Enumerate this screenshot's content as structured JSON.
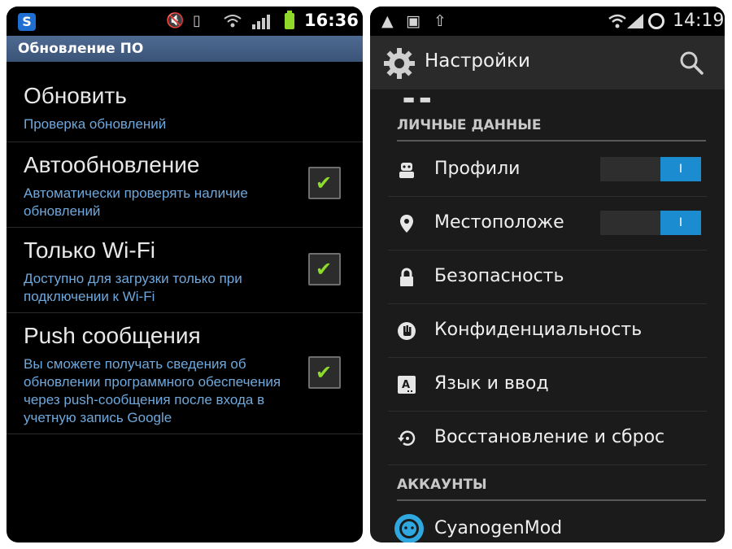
{
  "left_phone": {
    "status_bar": {
      "time": "16:36",
      "app_icon": "skype-icon"
    },
    "title": "Обновление ПО",
    "items": [
      {
        "title": "Обновить",
        "subtitle": "Проверка обновлений",
        "checkbox": false
      },
      {
        "title": "Автообновление",
        "subtitle": "Автоматически проверять наличие обновлений",
        "checkbox": true,
        "checked": true
      },
      {
        "title": "Только Wi-Fi",
        "subtitle": "Доступно для загрузки только при подключении к Wi-Fi",
        "checkbox": true,
        "checked": true
      },
      {
        "title": "Push сообщения",
        "subtitle": "Вы сможете получать сведения об обновлении программного обеспечения через push-сообщения после входа в учетную запись Google",
        "checkbox": true,
        "checked": true
      }
    ],
    "colors": {
      "title_bar": "#3f5a80",
      "subtitle_text": "#6fa8dc",
      "check_mark": "#8ddc2b"
    }
  },
  "right_phone": {
    "status_bar": {
      "time": "14:19"
    },
    "action_bar": {
      "title": "Настройки"
    },
    "sections": [
      {
        "header": "ЛИЧНЫЕ ДАННЫЕ",
        "items": [
          {
            "label": "Профили",
            "icon": "profile-robot-icon",
            "toggle": true,
            "toggle_label": "I"
          },
          {
            "label": "Местоположе",
            "icon": "location-pin-icon",
            "toggle": true,
            "toggle_label": "I"
          },
          {
            "label": "Безопасность",
            "icon": "lock-icon"
          },
          {
            "label": "Конфиденциальность",
            "icon": "privacy-hand-icon"
          },
          {
            "label": "Язык и ввод",
            "icon": "language-keyboard-icon"
          },
          {
            "label": "Восстановление и сброс",
            "icon": "restore-icon"
          }
        ]
      },
      {
        "header": "АККАУНТЫ",
        "items": [
          {
            "label": "CyanogenMod",
            "icon": "cyanogenmod-logo-icon"
          }
        ]
      }
    ],
    "colors": {
      "toggle_on": "#1a8ccf",
      "action_bar": "#2a2a2a"
    }
  }
}
